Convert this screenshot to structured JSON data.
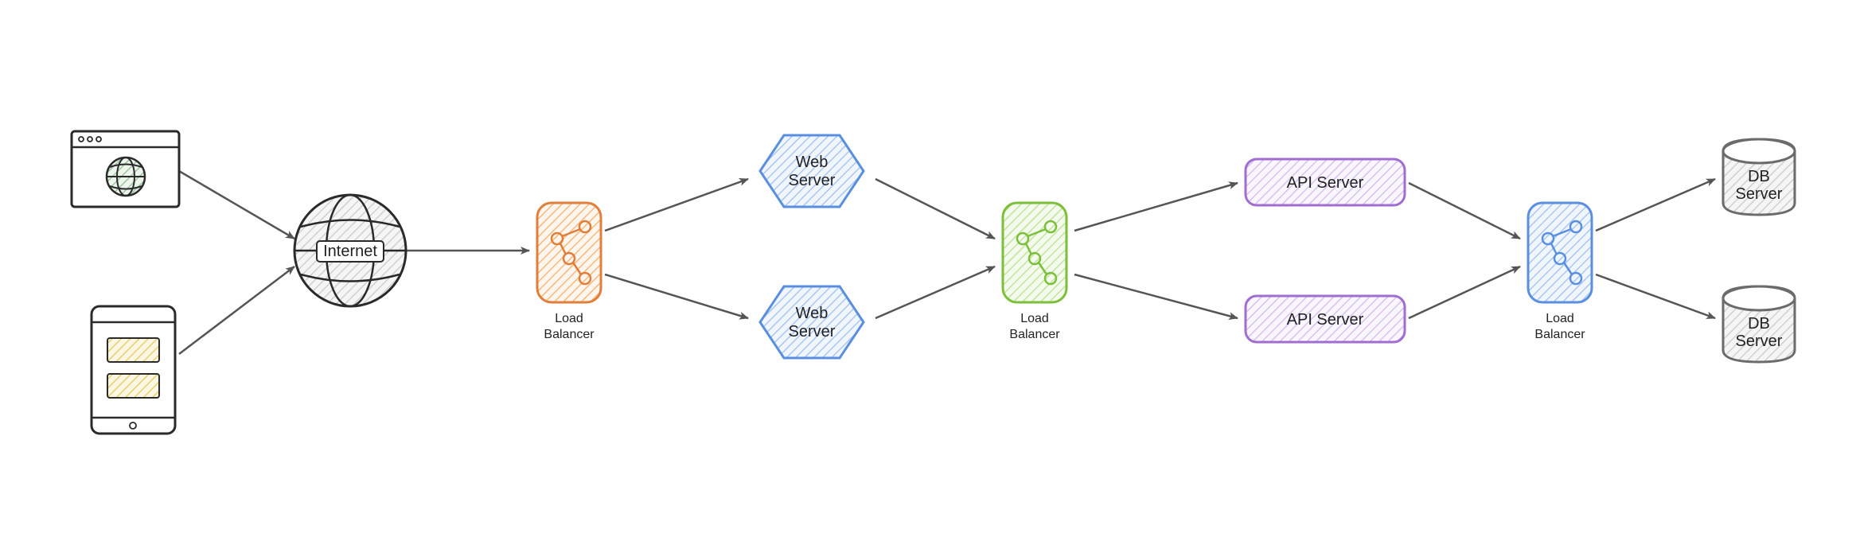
{
  "diagram": {
    "colors": {
      "browser_border": "#2a2a2a",
      "globe_green": "#5aa35a",
      "mobile_yellow": "#e8d06a",
      "internet_stroke": "#2a2a2a",
      "lb1_stroke": "#e07e3a",
      "lb1_fill": "#f7b97a",
      "lb2_stroke": "#7cbf3a",
      "lb2_fill": "#c1e59a",
      "lb3_stroke": "#5a8fe0",
      "lb3_fill": "#a9c8f2",
      "web_stroke": "#5a8fe0",
      "web_fill": "#a9c8f2",
      "api_stroke": "#a06ed0",
      "api_fill": "#d9c2ef",
      "db_stroke": "#6b6b6b",
      "db_fill": "#e9e9e9",
      "arrow": "#555555"
    },
    "nodes": {
      "browser": {
        "label": ""
      },
      "mobile": {
        "label": ""
      },
      "internet": {
        "label": "Internet"
      },
      "lb1": {
        "label_line1": "Load",
        "label_line2": "Balancer"
      },
      "web1": {
        "label_line1": "Web",
        "label_line2": "Server"
      },
      "web2": {
        "label_line1": "Web",
        "label_line2": "Server"
      },
      "lb2": {
        "label_line1": "Load",
        "label_line2": "Balancer"
      },
      "api1": {
        "label": "API Server"
      },
      "api2": {
        "label": "API Server"
      },
      "lb3": {
        "label_line1": "Load",
        "label_line2": "Balancer"
      },
      "db1": {
        "label_line1": "DB",
        "label_line2": "Server"
      },
      "db2": {
        "label_line1": "DB",
        "label_line2": "Server"
      }
    },
    "edges": [
      {
        "from": "browser",
        "to": "internet"
      },
      {
        "from": "mobile",
        "to": "internet"
      },
      {
        "from": "internet",
        "to": "lb1"
      },
      {
        "from": "lb1",
        "to": "web1"
      },
      {
        "from": "lb1",
        "to": "web2"
      },
      {
        "from": "web1",
        "to": "lb2"
      },
      {
        "from": "web2",
        "to": "lb2"
      },
      {
        "from": "lb2",
        "to": "api1"
      },
      {
        "from": "lb2",
        "to": "api2"
      },
      {
        "from": "api1",
        "to": "lb3"
      },
      {
        "from": "api2",
        "to": "lb3"
      },
      {
        "from": "lb3",
        "to": "db1"
      },
      {
        "from": "lb3",
        "to": "db2"
      }
    ]
  }
}
